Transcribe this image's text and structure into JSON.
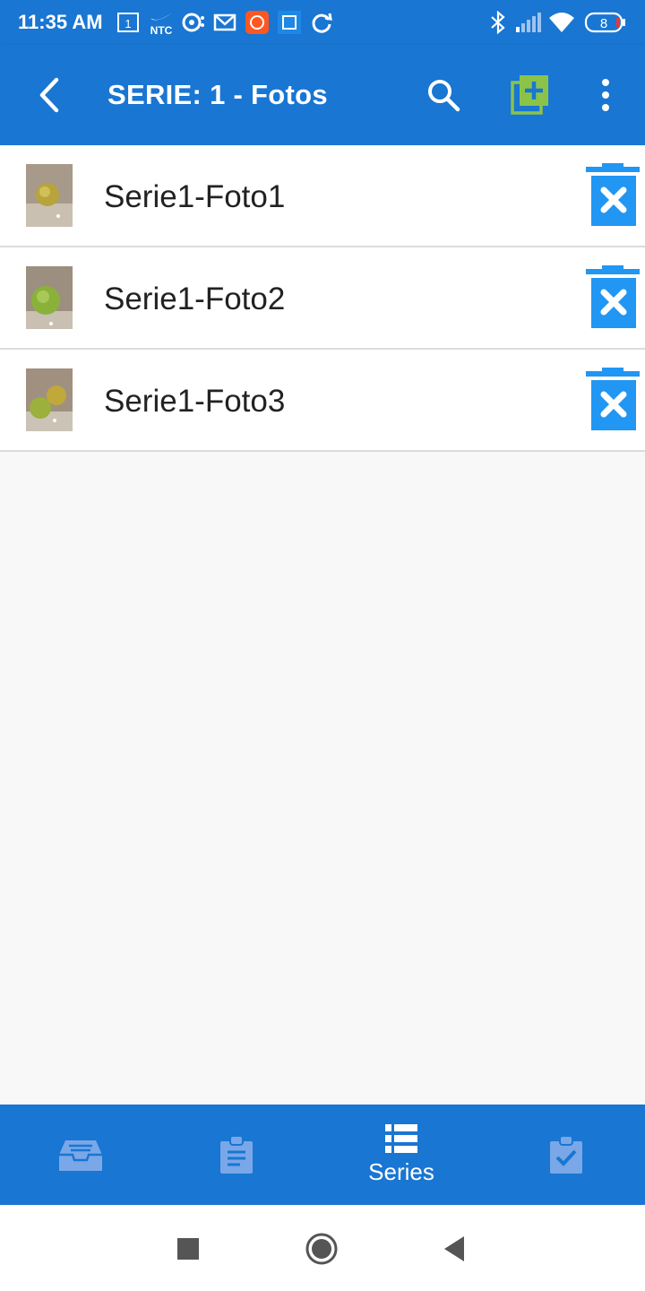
{
  "status_bar": {
    "time": "11:35 AM",
    "notification_icons": [
      "calendar-icon",
      "nike-ntc-icon",
      "media-icon",
      "gmail-icon",
      "mi-app-icon",
      "mi-device-icon",
      "sync-icon"
    ],
    "ntc_label": "NTC",
    "calendar_day": "1",
    "battery_level": "8"
  },
  "app_bar": {
    "title": "SERIE: 1 - Fotos",
    "accent_add_color": "#8bc34a"
  },
  "photos": [
    {
      "label": "Serie1-Foto1"
    },
    {
      "label": "Serie1-Foto2"
    },
    {
      "label": "Serie1-Foto3"
    }
  ],
  "bottom_nav": {
    "items": [
      {
        "icon": "inbox-icon",
        "label": ""
      },
      {
        "icon": "clipboard-icon",
        "label": ""
      },
      {
        "icon": "list-icon",
        "label": "Series",
        "active": true
      },
      {
        "icon": "clipboard-check-icon",
        "label": ""
      }
    ]
  },
  "colors": {
    "primary": "#1976d2",
    "delete": "#2196f3",
    "inactive_icon": "#7aa7e8"
  }
}
